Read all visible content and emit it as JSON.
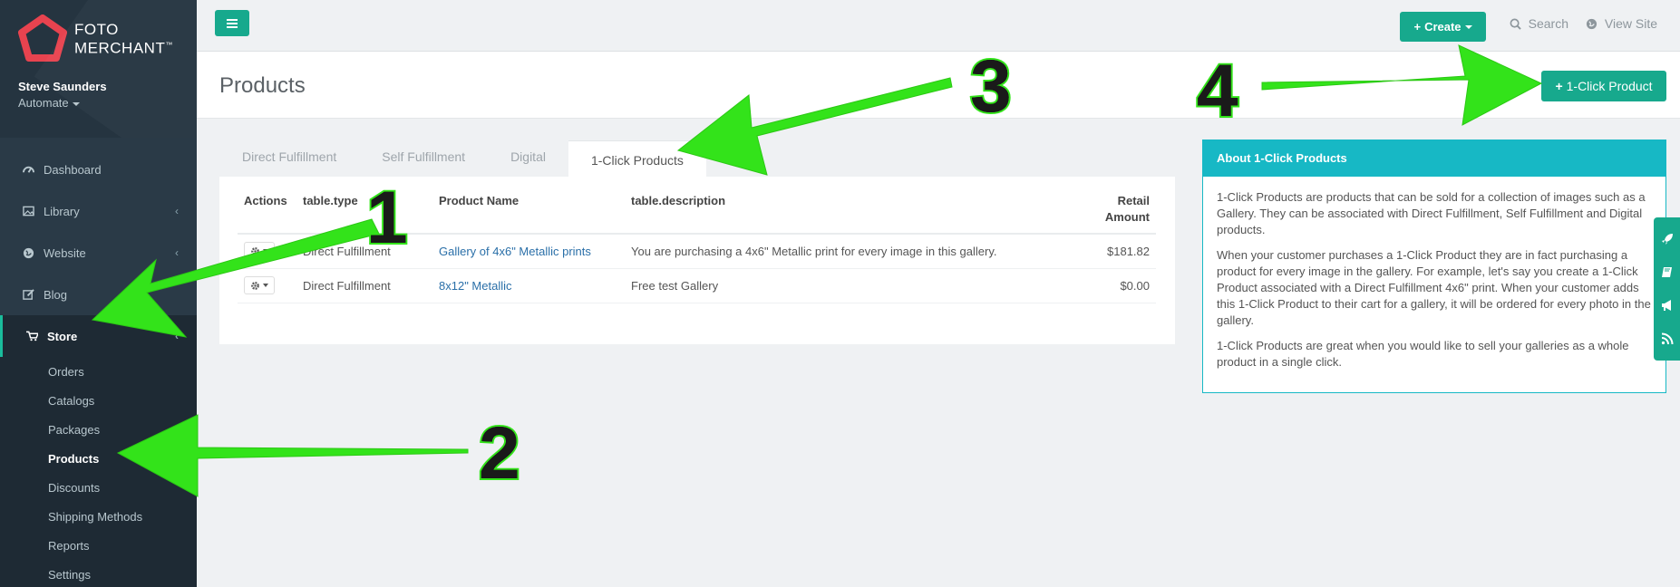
{
  "brand": {
    "line1": "FOTO",
    "line2": "MERCHANT",
    "tm": "™"
  },
  "user": {
    "name": "Steve Saunders",
    "role": "Automate"
  },
  "nav": [
    {
      "label": "Dashboard",
      "icon": "dashboard-icon"
    },
    {
      "label": "Library",
      "icon": "image-icon",
      "chevron": "‹"
    },
    {
      "label": "Website",
      "icon": "globe-icon",
      "chevron": "‹"
    },
    {
      "label": "Blog",
      "icon": "pencil-icon"
    },
    {
      "label": "Store",
      "icon": "cart-icon",
      "chevron": "‹"
    }
  ],
  "store_sub": [
    "Orders",
    "Catalogs",
    "Packages",
    "Products",
    "Discounts",
    "Shipping Methods",
    "Reports",
    "Settings"
  ],
  "topbar": {
    "create": "Create",
    "search": "Search",
    "view_site": "View Site"
  },
  "page": {
    "title": "Products",
    "action": "1-Click Product"
  },
  "tabs": [
    "Direct Fulfillment",
    "Self Fulfillment",
    "Digital",
    "1-Click Products"
  ],
  "table": {
    "headers": {
      "actions": "Actions",
      "type": "table.type",
      "name": "Product Name",
      "desc": "table.description",
      "amount_l1": "Retail",
      "amount_l2": "Amount"
    },
    "rows": [
      {
        "type": "Direct Fulfillment",
        "name": "Gallery of 4x6\" Metallic prints",
        "desc": "You are purchasing a 4x6\" Metallic print for every image in this gallery.",
        "amount": "$181.82"
      },
      {
        "type": "Direct Fulfillment",
        "name": "8x12\" Metallic",
        "desc": "Free test Gallery",
        "amount": "$0.00"
      }
    ]
  },
  "about": {
    "title": "About 1-Click Products",
    "p1": "1-Click Products are products that can be sold for a collection of images such as a Gallery. They can be associated with Direct Fulfillment, Self Fulfillment and Digital products.",
    "p2": "When your customer purchases a 1-Click Product they are in fact purchasing a product for every image in the gallery. For example, let's say you create a 1-Click Product associated with a Direct Fulfillment 4x6\" print. When your customer adds this 1-Click Product to their cart for a gallery, it will be ordered for every photo in the gallery.",
    "p3": "1-Click Products are great when you would like to sell your galleries as a whole product in a single click."
  },
  "annotations": [
    "1",
    "2",
    "3",
    "4"
  ],
  "colors": {
    "accent": "#17a98d",
    "sidebar": "#2a3a47",
    "info": "#17b8c5",
    "arrow": "#33e31a"
  }
}
